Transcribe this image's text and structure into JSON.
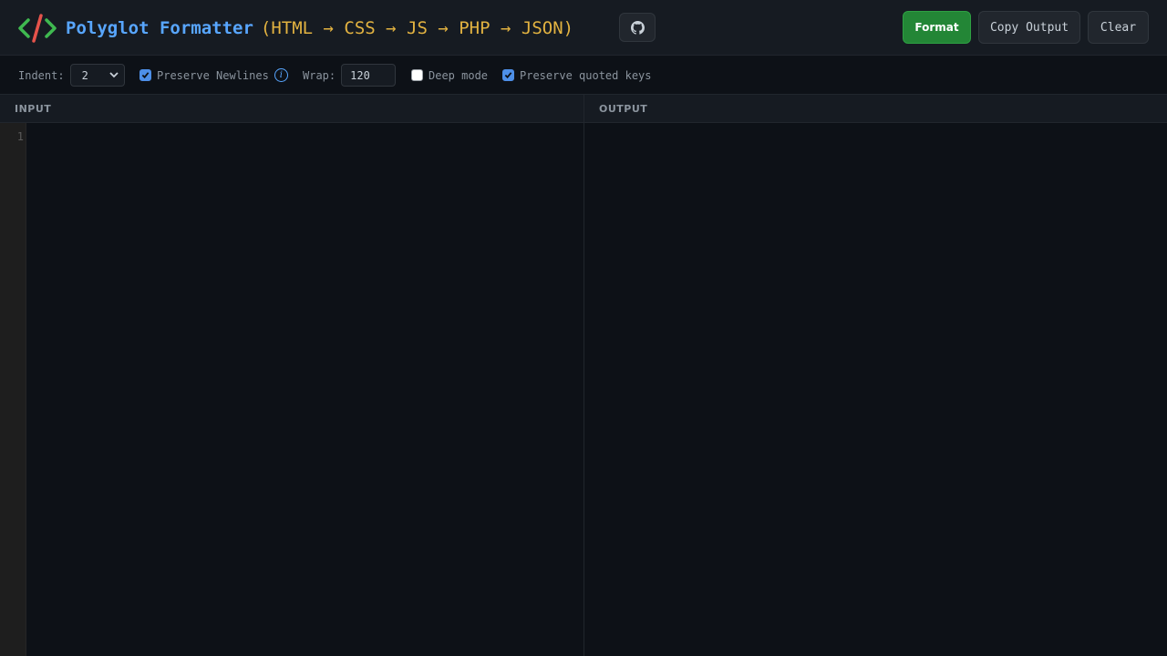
{
  "header": {
    "app_name": "Polyglot Formatter",
    "languages": "(HTML → CSS → JS → PHP → JSON)",
    "github_icon": "github-icon",
    "logo_icon": "code-brackets-icon",
    "buttons": {
      "format": "Format",
      "copy_output": "Copy Output",
      "clear": "Clear"
    }
  },
  "toolbar": {
    "indent_label": "Indent:",
    "indent_value": "2",
    "preserve_newlines_label": "Preserve Newlines",
    "preserve_newlines_checked": true,
    "wrap_label": "Wrap:",
    "wrap_value": "120",
    "deep_mode_label": "Deep mode",
    "deep_mode_checked": false,
    "preserve_quoted_keys_label": "Preserve quoted keys",
    "preserve_quoted_keys_checked": true
  },
  "panes": {
    "input_title": "INPUT",
    "output_title": "OUTPUT",
    "line_numbers": [
      "1"
    ],
    "output_text": ""
  },
  "colors": {
    "accent_blue": "#58a6ff",
    "accent_yellow": "#e3b341",
    "format_green": "#238636",
    "background": "#0d1117"
  }
}
